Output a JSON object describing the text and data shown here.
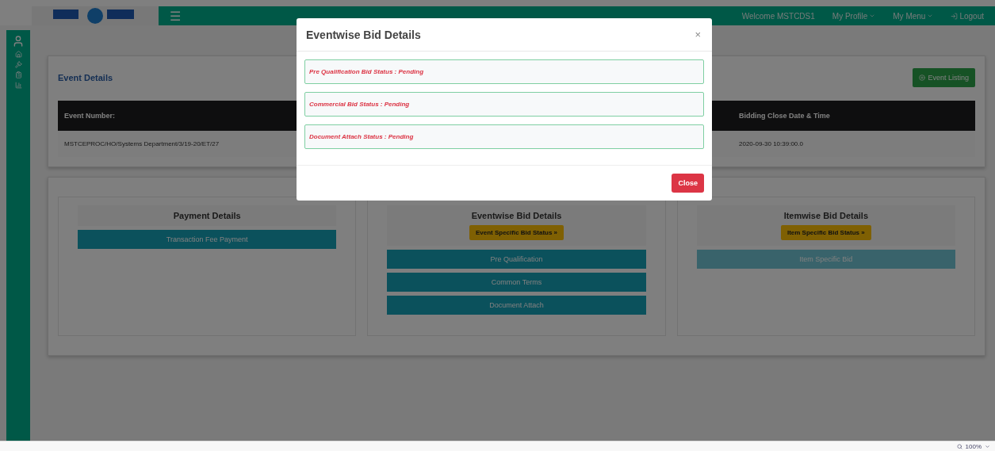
{
  "header": {
    "menu_icon": "☰",
    "welcome": "Welcome MSTCDS1",
    "nav": [
      {
        "label": "My Profile",
        "dropdown": true
      },
      {
        "label": "My Menu",
        "dropdown": true
      },
      {
        "label": "Logout",
        "dropdown": false
      }
    ]
  },
  "sidebar": {
    "items": [
      {
        "kind": "user"
      },
      {
        "kind": "home"
      },
      {
        "kind": "gavel"
      },
      {
        "kind": "list"
      },
      {
        "kind": "chart"
      }
    ]
  },
  "event_details": {
    "title": "Event Details",
    "listing_button": "Event Listing",
    "columns": [
      {
        "heading": "Event Number:",
        "value": "MSTCEPROC/HO/Systems Department/3/19-20/ET/27"
      },
      {
        "heading": "Bidding Close Date & Time",
        "value": "2020-09-30 10:39:00.0"
      }
    ]
  },
  "panels": [
    {
      "title": "Payment Details",
      "buttons": [
        {
          "label": "Transaction Fee Payment",
          "disabled": false
        }
      ]
    },
    {
      "title": "Eventwise Bid Details",
      "badge": "Event Specific Bid Status »",
      "buttons": [
        {
          "label": "Pre Qualification",
          "disabled": false
        },
        {
          "label": "Common Terms",
          "disabled": false
        },
        {
          "label": "Document Attach",
          "disabled": false
        }
      ]
    },
    {
      "title": "Itemwise Bid Details",
      "badge": "Item Specific Bid Status »",
      "buttons": [
        {
          "label": "Item Specific Bid",
          "disabled": true
        }
      ]
    }
  ],
  "modal": {
    "title": "Eventwise Bid Details",
    "close_icon": "×",
    "statuses": [
      "Pre Qualification Bid Status : Pending",
      "Commercial Bid Status : Pending",
      "Document Attach Status : Pending"
    ],
    "close_button": "Close"
  },
  "status_bar": {
    "zoom": "100%"
  }
}
